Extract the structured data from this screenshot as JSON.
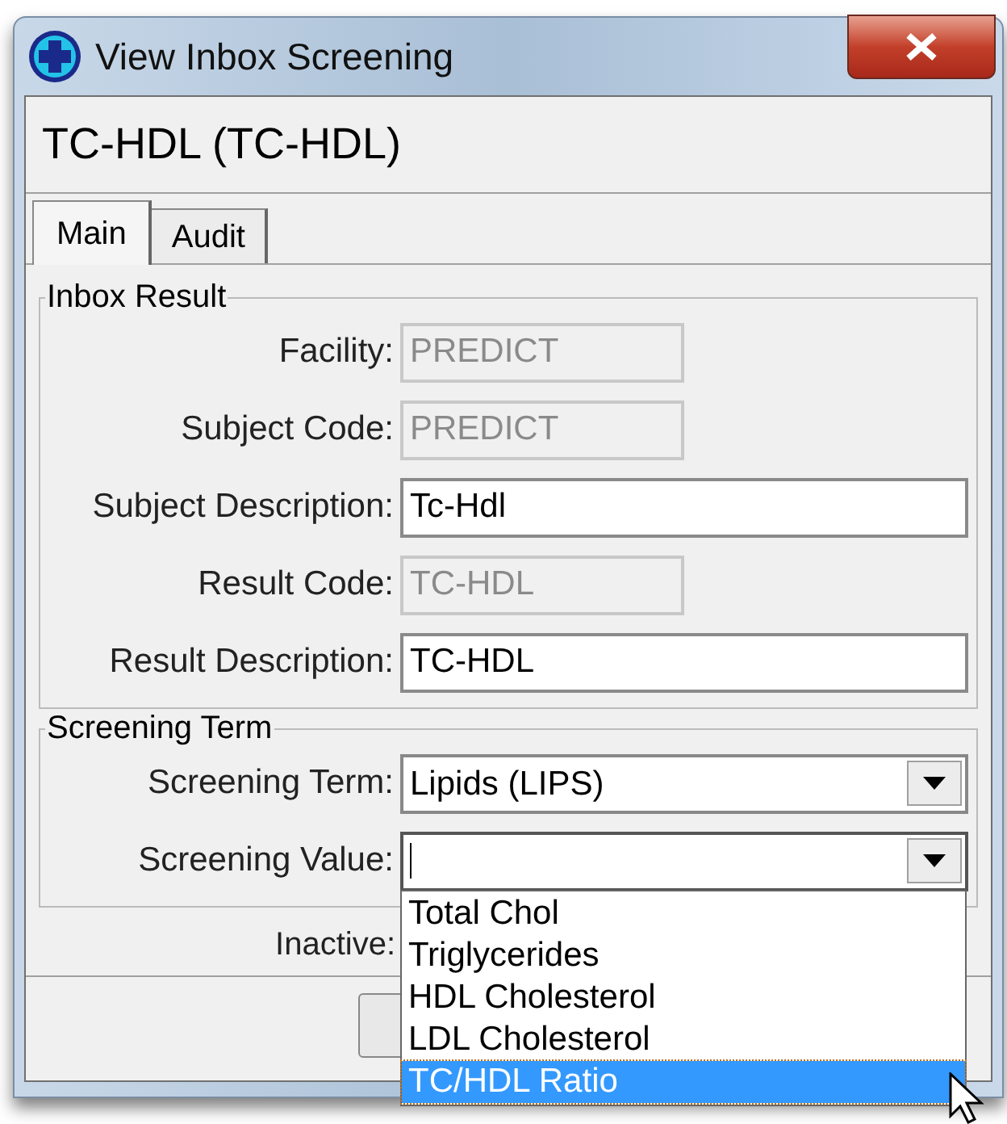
{
  "window": {
    "title": "View Inbox Screening"
  },
  "header": {
    "title": "TC-HDL (TC-HDL)"
  },
  "tabs": [
    {
      "label": "Main",
      "selected": true
    },
    {
      "label": "Audit",
      "selected": false
    }
  ],
  "inbox_result": {
    "title": "Inbox Result",
    "fields": [
      {
        "label": "Facility:",
        "value": "PREDICT",
        "disabled": true
      },
      {
        "label": "Subject Code:",
        "value": "PREDICT",
        "disabled": true
      },
      {
        "label": "Subject Description:",
        "value": "Tc-Hdl",
        "disabled": false
      },
      {
        "label": "Result Code:",
        "value": "TC-HDL",
        "disabled": true
      },
      {
        "label": "Result Description:",
        "value": "TC-HDL",
        "disabled": false
      }
    ]
  },
  "screening_term": {
    "title": "Screening Term",
    "combos": [
      {
        "label": "Screening Term:",
        "value": "Lipids (LIPS)",
        "focused": false
      },
      {
        "label": "Screening Value:",
        "focused": true
      }
    ]
  },
  "inactive": {
    "label": "Inactive:"
  },
  "dropdown": {
    "items": [
      {
        "label": "Total Chol",
        "selected": false
      },
      {
        "label": "Triglycerides",
        "selected": false
      },
      {
        "label": "HDL Cholesterol",
        "selected": false
      },
      {
        "label": "LDL Cholesterol",
        "selected": false
      },
      {
        "label": "TC/HDL Ratio",
        "selected": true
      }
    ]
  }
}
